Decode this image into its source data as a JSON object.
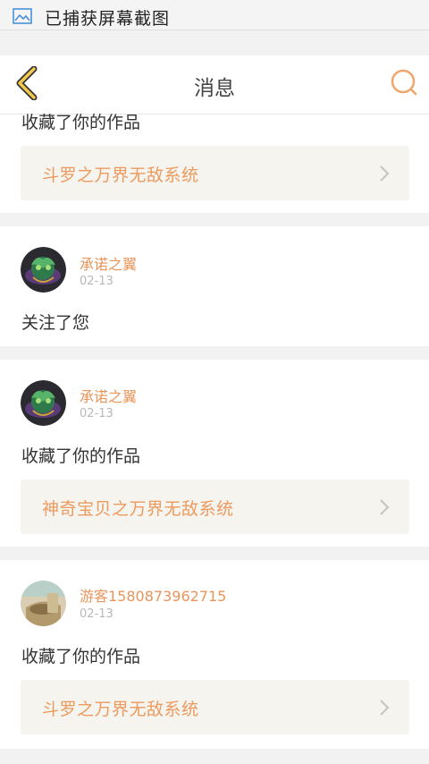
{
  "statusbar": {
    "notification_text": "已捕获屏幕截图",
    "icon": "image-icon"
  },
  "header": {
    "title": "消息",
    "back_icon": "back-chevron-icon",
    "search_icon": "search-icon"
  },
  "colors": {
    "accent": "#e8955a",
    "back_arrow": "#f2c94c",
    "link_bg": "#f5f4ef",
    "page_bg": "#f2f2f2"
  },
  "messages": [
    {
      "action": "收藏了你的作品",
      "work": "斗罗之万界无敌系统"
    },
    {
      "user": "承诺之翼",
      "date": "02-13",
      "action": "关注了您"
    },
    {
      "user": "承诺之翼",
      "date": "02-13",
      "action": "收藏了你的作品",
      "work": "神奇宝贝之万界无敌系统"
    },
    {
      "user": "游客1580873962715",
      "date": "02-13",
      "action": "收藏了你的作品",
      "work": "斗罗之万界无敌系统"
    }
  ]
}
